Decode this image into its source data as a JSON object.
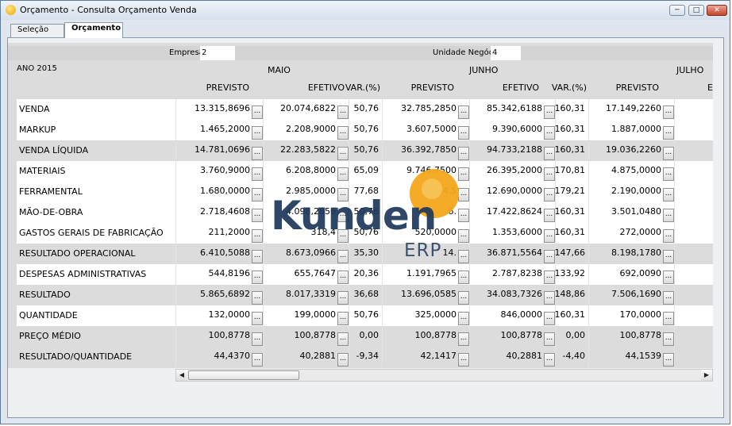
{
  "window": {
    "title": "Orçamento - Consulta Orçamento Venda"
  },
  "tabs": [
    {
      "label": "Seleção"
    },
    {
      "label": "Orçamento"
    }
  ],
  "header": {
    "empresa_label": "Empresa",
    "empresa_value": "2",
    "unidade_label": "Unidade Negócio",
    "unidade_value": "4",
    "ano": "ANO 2015"
  },
  "months": [
    "MAIO",
    "JUNHO",
    "JULHO"
  ],
  "columns": [
    "PREVISTO",
    "EFETIVO",
    "VAR.(%)",
    "PREVISTO",
    "EFETIVO",
    "VAR.(%)",
    "PREVISTO",
    "E"
  ],
  "ellipsis": "...",
  "rows": [
    {
      "label": "VENDA",
      "values": [
        "13.315,8696",
        "20.074,6822",
        "50,76",
        "32.785,2850",
        "85.342,6188",
        "160,31",
        "17.149,2260"
      ]
    },
    {
      "label": "MARKUP",
      "values": [
        "1.465,2000",
        "2.208,9000",
        "50,76",
        "3.607,5000",
        "9.390,6000",
        "160,31",
        "1.887,0000"
      ]
    },
    {
      "label": "VENDA LÍQUIDA",
      "values": [
        "14.781,0696",
        "22.283,5822",
        "50,76",
        "36.392,7850",
        "94.733,2188",
        "160,31",
        "19.036,2260"
      ]
    },
    {
      "label": "MATERIAIS",
      "values": [
        "3.760,9000",
        "6.208,8000",
        "65,09",
        "9.746,7500",
        "26.395,2000",
        "170,81",
        "4.875,0000"
      ]
    },
    {
      "label": "FERRAMENTAL",
      "values": [
        "1.680,0000",
        "2.985,0000",
        "77,68",
        "4.5",
        "12.690,0000",
        "179,21",
        "2.190,0000"
      ]
    },
    {
      "label": "MÃO-DE-OBRA",
      "values": [
        "2.718,4608",
        "4.098,2856",
        "50,76",
        "6.",
        "17.422,8624",
        "160,31",
        "3.501,0480"
      ]
    },
    {
      "label": "GASTOS GERAIS DE FABRICAÇÃO",
      "values": [
        "211,2000",
        "318,4",
        "50,76",
        "520,0000",
        "1.353,6000",
        "160,31",
        "272,0000"
      ]
    },
    {
      "label": "RESULTADO OPERACIONAL",
      "values": [
        "6.410,5088",
        "8.673,0966",
        "35,30",
        "14.",
        "36.871,5564",
        "147,66",
        "8.198,1780"
      ]
    },
    {
      "label": "DESPESAS ADMINISTRATIVAS",
      "values": [
        "544,8196",
        "655,7647",
        "20,36",
        "1.191,7965",
        "2.787,8238",
        "133,92",
        "692,0090"
      ]
    },
    {
      "label": "RESULTADO",
      "values": [
        "5.865,6892",
        "8.017,3319",
        "36,68",
        "13.696,0585",
        "34.083,7326",
        "148,86",
        "7.506,1690"
      ]
    },
    {
      "label": "QUANTIDADE",
      "values": [
        "132,0000",
        "199,0000",
        "50,76",
        "325,0000",
        "846,0000",
        "160,31",
        "170,0000"
      ]
    },
    {
      "label": "PREÇO MÉDIO",
      "values": [
        "100,8778",
        "100,8778",
        "0,00",
        "100,8778",
        "100,8778",
        "0,00",
        "100,8778"
      ]
    },
    {
      "label": "RESULTADO/QUANTIDADE",
      "values": [
        "44,4370",
        "40,2881",
        "-9,34",
        "42,1417",
        "40,2881",
        "-4,40",
        "44,1539"
      ]
    }
  ],
  "shaded_rows": [
    2,
    7,
    9,
    11,
    12
  ],
  "watermark": {
    "brand": "Kunden",
    "sub": "ERP",
    "color_primary": "#1f3a5c",
    "color_accent": "#f3a81c"
  },
  "scrollbar": {
    "left_icon": "arrow-left-icon",
    "right_icon": "arrow-right-icon"
  }
}
